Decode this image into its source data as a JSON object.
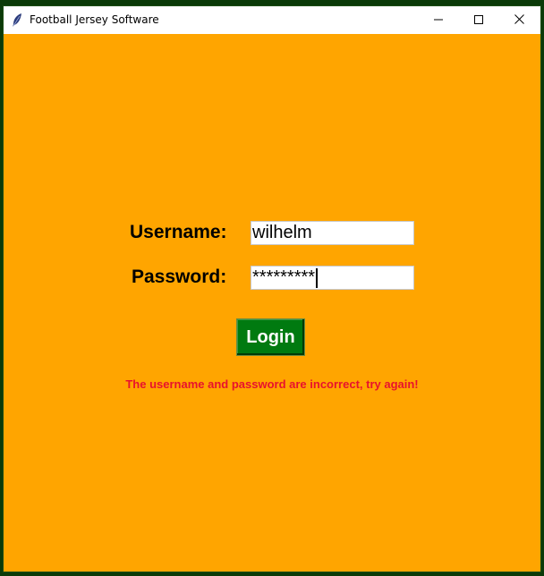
{
  "window": {
    "title": "Football Jersey Software",
    "controls": {
      "minimize": "minimize",
      "maximize": "maximize",
      "close": "close"
    }
  },
  "form": {
    "username_label": "Username:",
    "username_value": "wilhelm",
    "password_label": "Password:",
    "password_value": "*********",
    "login_label": "Login"
  },
  "error_message": "The username and password are incorrect, try again!",
  "colors": {
    "background": "#ffa500",
    "login_button": "#007a10",
    "error_text": "#e8122d",
    "desktop": "#0b3a08"
  },
  "icons": [
    "feather-icon",
    "minimize-icon",
    "maximize-icon",
    "close-icon"
  ]
}
